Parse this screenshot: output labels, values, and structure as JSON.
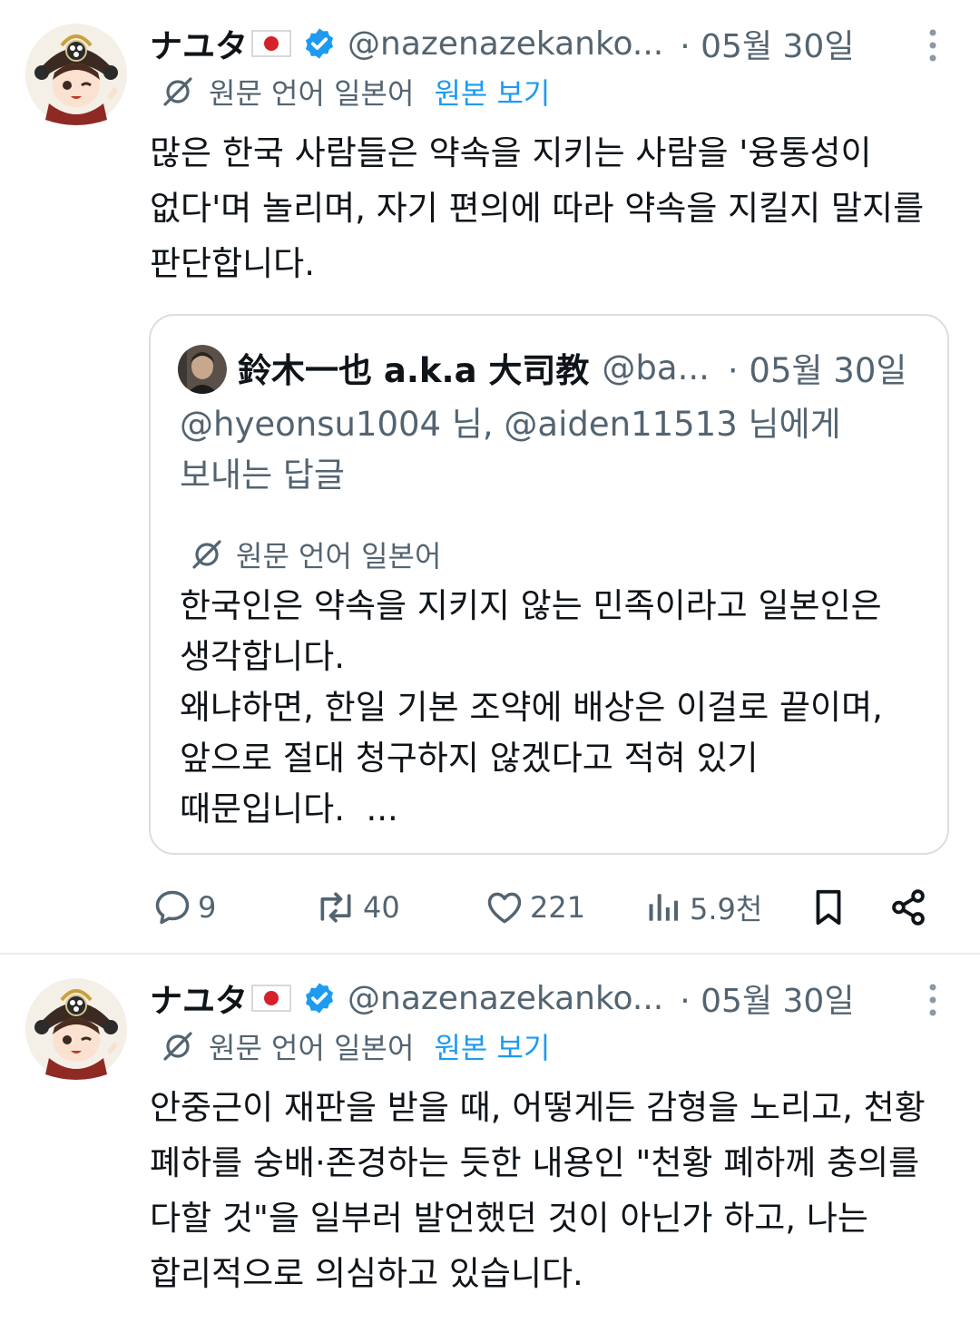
{
  "tweets": [
    {
      "display_name": "ナユタ",
      "handle": "@nazenazekanko...",
      "date": "· 05월 30일",
      "translate_label": "원문 언어 일본어",
      "view_original": "원본 보기",
      "body": "많은 한국 사람들은 약속을 지키는 사람을 '융통성이\n없다'며 놀리며, 자기 편의에 따라 약속을 지킬지 말지를\n판단합니다.",
      "quote": {
        "display_name": "鈴木一也 a.k.a 大司教",
        "handle": "@ba...",
        "date": "· 05월 30일",
        "reply_to": "@hyeonsu1004 님, @aiden11513 님에게\n보내는 답글",
        "translate_label": "원문 언어 일본어",
        "body": "한국인은 약속을 지키지 않는 민족이라고 일본인은\n생각합니다.\n왜냐하면, 한일 기본 조약에 배상은 이걸로 끝이며,\n앞으로 절대 청구하지 않겠다고 적혀 있기\n때문입니다.  ..."
      },
      "actions": {
        "replies": "9",
        "reposts": "40",
        "likes": "221",
        "views": "5.9천"
      }
    },
    {
      "display_name": "ナユタ",
      "handle": "@nazenazekanko...",
      "date": "· 05월 30일",
      "translate_label": "원문 언어 일본어",
      "view_original": "원본 보기",
      "body": "안중근이 재판을 받을 때, 어떻게든 감형을 노리고, 천황\n폐하를 숭배·존경하는 듯한 내용인 \"천황 폐하께 충의를\n다할 것\"을 일부러 발언했던 것이 아닌가 하고, 나는\n합리적으로 의심하고 있습니다."
    }
  ],
  "colors": {
    "text": "#0f1419",
    "secondary": "#536471",
    "link": "#1d9bf0",
    "verified": "#1d9bf0",
    "border": "#d9dee2"
  }
}
